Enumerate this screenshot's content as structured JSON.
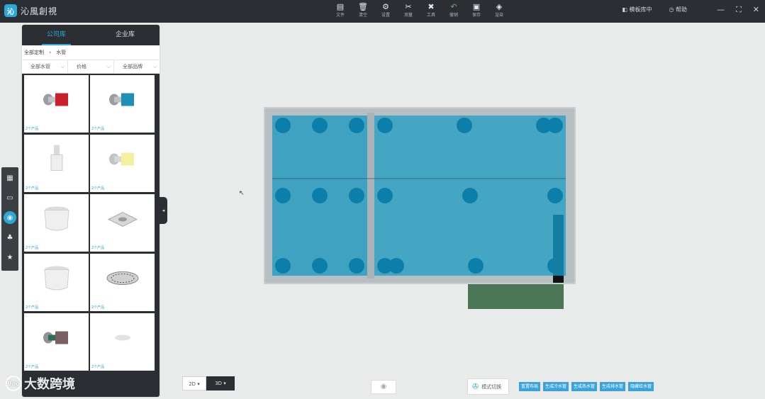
{
  "app": {
    "logo_text": "沁風創視",
    "logo_glyph": "沁"
  },
  "toolbar": {
    "items": [
      {
        "icon": "file-icon",
        "glyph": "▤",
        "label": "文件"
      },
      {
        "icon": "trash-icon",
        "glyph": "🗑",
        "label": "清空"
      },
      {
        "icon": "gear-icon",
        "glyph": "⚙",
        "label": "设置"
      },
      {
        "icon": "tools-icon",
        "glyph": "✂",
        "label": "测量"
      },
      {
        "icon": "wrench-icon",
        "glyph": "✖",
        "label": "工具"
      },
      {
        "icon": "undo-icon",
        "glyph": "↶",
        "label": "撤销"
      },
      {
        "icon": "save-icon",
        "glyph": "▣",
        "label": "保存"
      },
      {
        "icon": "cube-icon",
        "glyph": "◈",
        "label": "渲染"
      }
    ],
    "right_links": [
      "◧ 模板库中",
      "◷ 帮助"
    ],
    "window_controls": [
      "—",
      "⛶",
      "✕"
    ]
  },
  "left_tools": [
    {
      "icon": "building-icon",
      "glyph": "▦"
    },
    {
      "icon": "sofa-icon",
      "glyph": "▭"
    },
    {
      "icon": "water-icon",
      "glyph": "◉"
    },
    {
      "icon": "bike-icon",
      "glyph": "♣"
    },
    {
      "icon": "star-icon",
      "glyph": "★"
    }
  ],
  "library": {
    "tabs": [
      "公司库",
      "企业库"
    ],
    "active_tab": 0,
    "breadcrumb": [
      "全部定制",
      "›",
      "水管"
    ],
    "filters": [
      "全部水管",
      "价格",
      "全部品牌"
    ],
    "items": [
      {
        "caption": "2个产品",
        "thumb": "valve-red"
      },
      {
        "caption": "2个产品",
        "thumb": "valve-blue"
      },
      {
        "caption": "2个产品",
        "thumb": "pipe-grey"
      },
      {
        "caption": "2个产品",
        "thumb": "valve-yellow"
      },
      {
        "caption": "2个产品",
        "thumb": "cup"
      },
      {
        "caption": "2个产品",
        "thumb": "drain-square"
      },
      {
        "caption": "2个产品",
        "thumb": "cup"
      },
      {
        "caption": "2个产品",
        "thumb": "drain-round"
      },
      {
        "caption": "2个产品",
        "thumb": "valve-dark"
      },
      {
        "caption": "2个产品",
        "thumb": "plate"
      }
    ]
  },
  "bottom": {
    "view_2d": "2D ▾",
    "view_3d": "3D ▾",
    "eye_glyph": "◉",
    "switch_label": "模式切换",
    "switch_icon": "✇",
    "actions": [
      "重置布局",
      "生成冷水管",
      "生成热水管",
      "生成排水管",
      "隐藏给水管"
    ]
  },
  "watermark": {
    "text": "大数跨境",
    "icon": "Boo"
  },
  "colors": {
    "topbar": "#2b2f33",
    "accent": "#2aa8d6",
    "room_fill": "#3fa2c1",
    "dot": "#0b7faa",
    "green_block": "#4b7656"
  }
}
